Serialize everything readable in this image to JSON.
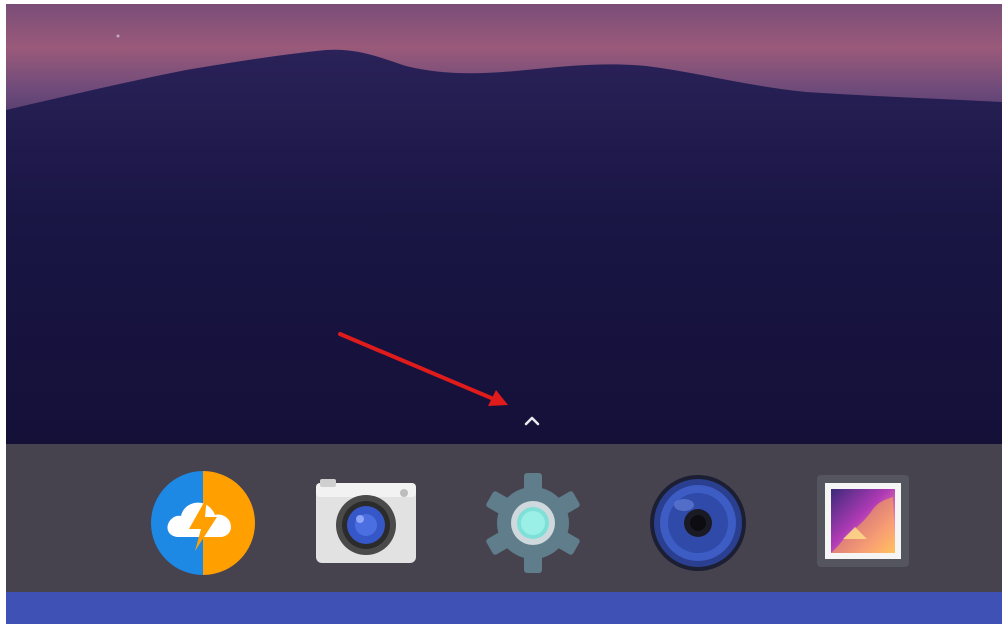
{
  "colors": {
    "wallpaper_sky_top": "#7a4d78",
    "wallpaper_dark": "#15123a",
    "dock_background": "#46434f",
    "nav_bar": "#3f51b5",
    "annotation_arrow": "#e01b1b",
    "swipe_hint": "#e8e8ee"
  },
  "swipe_hint": {
    "icon": "chevron-up-icon"
  },
  "dock": {
    "apps": [
      {
        "icon": "cloud-bolt-icon"
      },
      {
        "icon": "camera-icon"
      },
      {
        "icon": "gear-icon"
      },
      {
        "icon": "speaker-icon"
      },
      {
        "icon": "gallery-icon"
      }
    ]
  },
  "annotation": {
    "icon": "red-arrow-icon"
  }
}
